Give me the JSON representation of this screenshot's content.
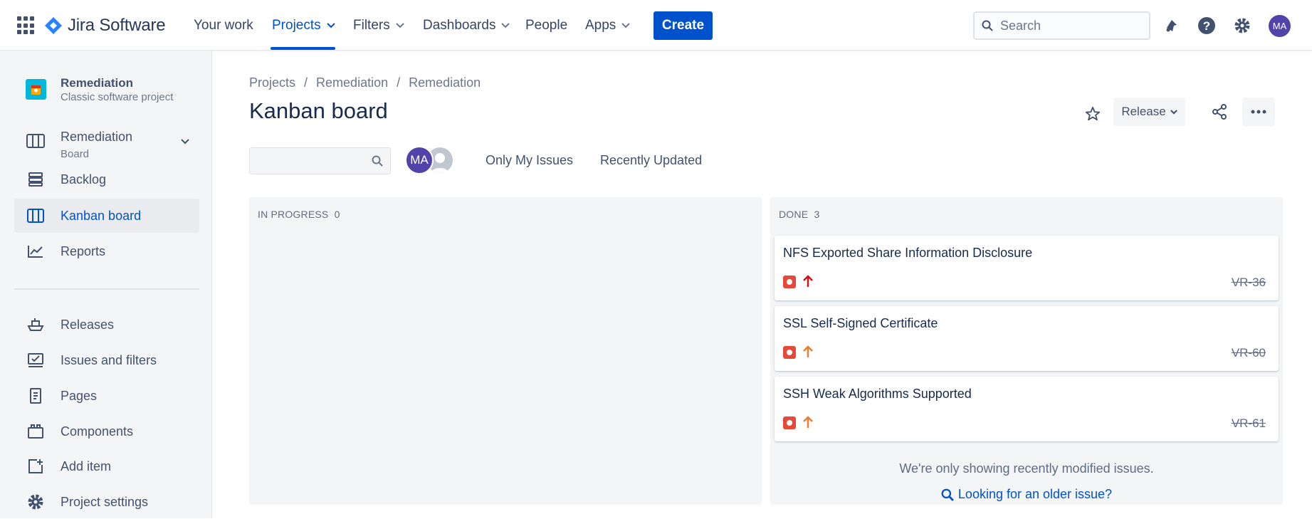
{
  "app": {
    "name": "Jira Software"
  },
  "nav": {
    "your_work": "Your work",
    "projects": "Projects",
    "filters": "Filters",
    "dashboards": "Dashboards",
    "people": "People",
    "apps": "Apps",
    "create": "Create",
    "search_placeholder": "Search",
    "avatar_initials": "MA"
  },
  "sidebar": {
    "project_name": "Remediation",
    "project_type": "Classic software project",
    "board_name": "Remediation",
    "board_sub": "Board",
    "items": [
      {
        "label": "Backlog",
        "icon": "backlog-icon"
      },
      {
        "label": "Kanban board",
        "icon": "board-icon",
        "selected": true
      },
      {
        "label": "Reports",
        "icon": "reports-icon"
      },
      {
        "label": "Releases",
        "icon": "ship-icon"
      },
      {
        "label": "Issues and filters",
        "icon": "issues-icon"
      },
      {
        "label": "Pages",
        "icon": "page-icon"
      },
      {
        "label": "Components",
        "icon": "component-icon"
      },
      {
        "label": "Add item",
        "icon": "add-item-icon"
      },
      {
        "label": "Project settings",
        "icon": "gear-icon"
      }
    ]
  },
  "main": {
    "breadcrumb": [
      "Projects",
      "Remediation",
      "Remediation"
    ],
    "title": "Kanban board",
    "release_label": "Release",
    "avatar_initials": "MA",
    "filters": [
      "Only My Issues",
      "Recently Updated"
    ],
    "columns": [
      {
        "name": "IN PROGRESS",
        "count": "0",
        "cards": []
      },
      {
        "name": "DONE",
        "count": "3",
        "cards": [
          {
            "title": "NFS Exported Share Information Disclosure",
            "key": "VR-36",
            "priority": "highest",
            "priority_color": "#cd1317"
          },
          {
            "title": "SSL Self-Signed Certificate",
            "key": "VR-60",
            "priority": "high",
            "priority_color": "#e97f33"
          },
          {
            "title": "SSH Weak Algorithms Supported",
            "key": "VR-61",
            "priority": "high",
            "priority_color": "#e97f33"
          }
        ],
        "note": "We're only showing recently modified issues.",
        "link": "Looking for an older issue?"
      }
    ]
  },
  "colors": {
    "accent": "#0052cc",
    "bug": "#e5493a",
    "avatar": "#5243aa"
  }
}
